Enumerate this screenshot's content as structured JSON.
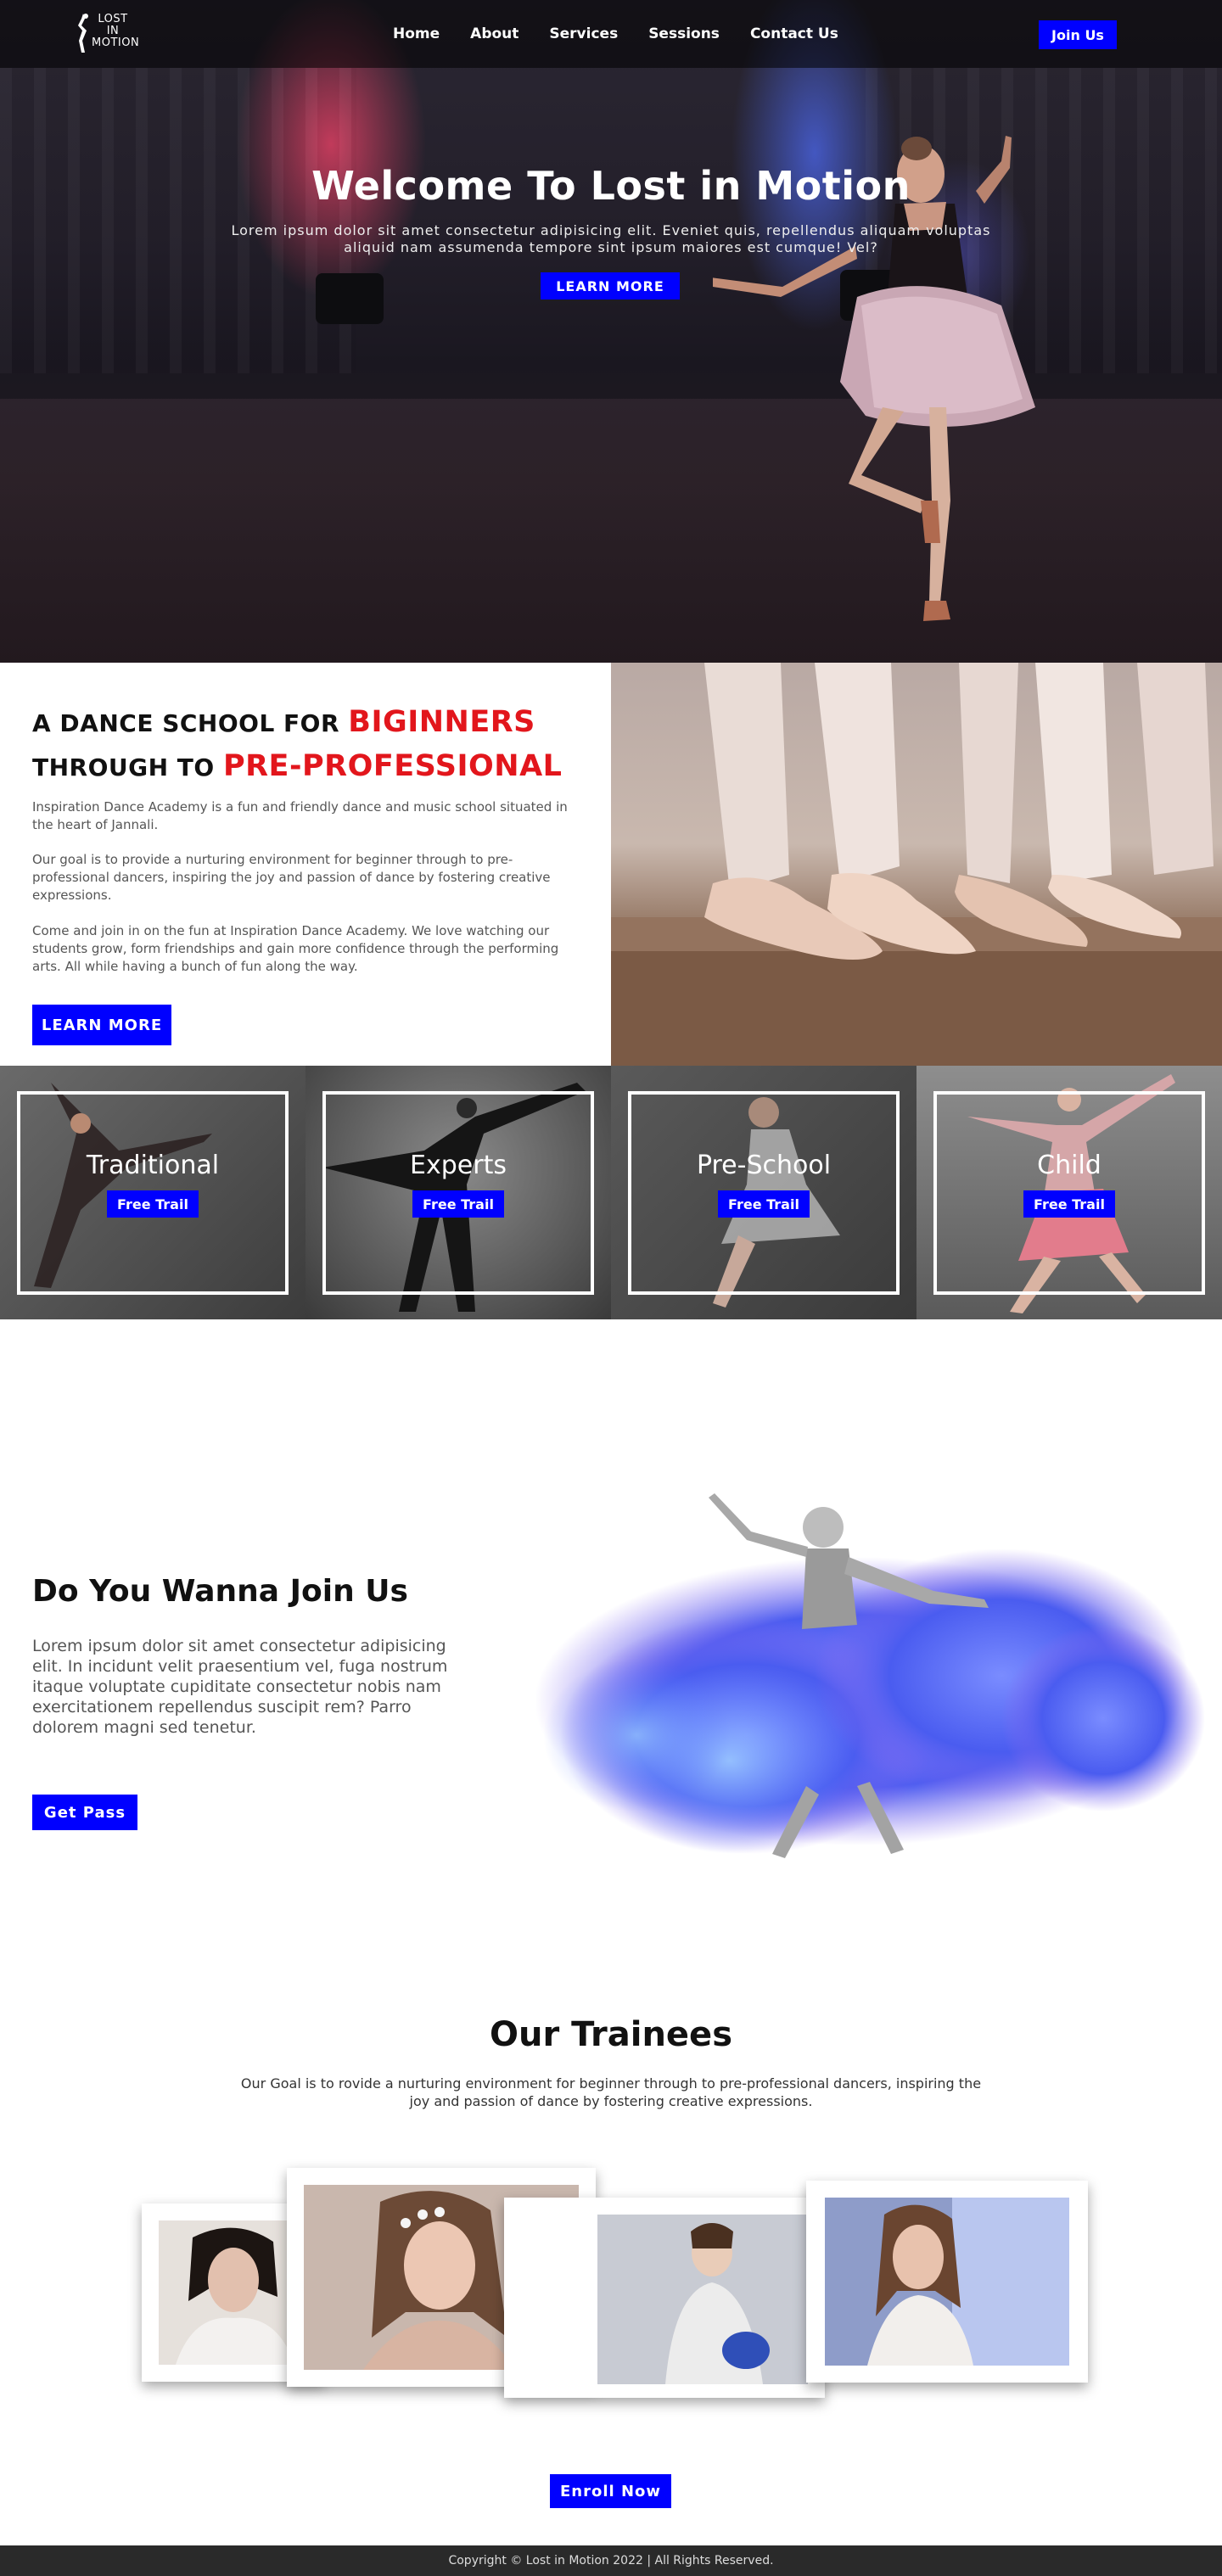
{
  "nav": {
    "logo_lines": [
      "LOST",
      "IN",
      "MOTION"
    ],
    "items": [
      {
        "label": "Home"
      },
      {
        "label": "About"
      },
      {
        "label": "Services"
      },
      {
        "label": "Sessions"
      },
      {
        "label": "Contact Us"
      }
    ],
    "join_label": "Join Us"
  },
  "hero": {
    "title": "Welcome To Lost in Motion",
    "subtitle": "Lorem ipsum dolor sit amet consectetur adipisicing elit. Eveniet quis, repellendus aliquam voluptas aliquid nam assumenda tempore sint ipsum maiores est cumque! Vel?",
    "button_label": "LEARN MORE"
  },
  "about": {
    "heading_line1_prefix": "A DANCE SCHOOL FOR ",
    "heading_line1_highlight": "BIGINNERS",
    "heading_line2_prefix": "THROUGH TO ",
    "heading_line2_highlight": "PRE-PROFESSIONAL",
    "paragraphs": [
      "Inspiration Dance Academy is a fun and friendly dance and music school situated in the heart of Jannali.",
      "Our goal is to provide a nurturing environment for beginner through to pre-professional dancers, inspiring the joy and passion of dance by fostering creative expressions.",
      "Come and join in on the fun at Inspiration Dance Academy. We love watching our students grow, form friendships and gain more confidence through the performing arts. All while having a bunch of fun along the way."
    ],
    "button_label": "LEARN MORE"
  },
  "categories": [
    {
      "label": "Traditional",
      "button": "Free Trail"
    },
    {
      "label": "Experts",
      "button": "Free Trail"
    },
    {
      "label": "Pre-School",
      "button": "Free Trail"
    },
    {
      "label": "Child",
      "button": "Free Trail"
    }
  ],
  "join": {
    "heading": "Do You Wanna Join Us",
    "text": "Lorem ipsum dolor sit amet consectetur adipisicing elit. In incidunt velit praesentium vel, fuga nostrum itaque voluptate cupiditate consectetur nobis nam exercitationem repellendus suscipit rem? Parro dolorem magni sed tenetur.",
    "button_label": "Get Pass"
  },
  "trainees": {
    "heading": "Our Trainees",
    "text": "Our Goal is to rovide a nurturing environment for beginner through to pre-professional dancers, inspiring the joy and passion of dance by fostering creative expressions.",
    "button_label": "Enroll Now"
  },
  "footer": {
    "text": "Copyright © Lost in Motion 2022 | All Rights Reserved."
  },
  "colors": {
    "accent": "#0000ff",
    "highlight_red": "#e2161c",
    "footer_bg": "#2a2a2a"
  }
}
